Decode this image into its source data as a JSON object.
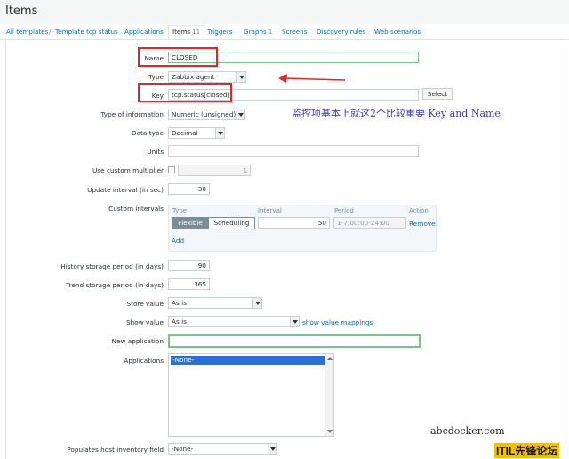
{
  "page_title": "Items",
  "tabs": [
    {
      "label": "All templates"
    },
    {
      "label": "Template tcp status"
    },
    {
      "label": "Applications"
    },
    {
      "label": "Items",
      "count": "11"
    },
    {
      "label": "Triggers"
    },
    {
      "label": "Graphs",
      "count": "1"
    },
    {
      "label": "Screens"
    },
    {
      "label": "Discovery rules"
    },
    {
      "label": "Web scenarios"
    }
  ],
  "breadcrumb_separator": "/",
  "form": {
    "name_label": "Name",
    "name_value": "CLOSED",
    "type_label": "Type",
    "type_value": "Zabbix agent",
    "key_label": "Key",
    "key_value": "tcp.status[closed]",
    "select_button": "Select",
    "type_info_label": "Type of information",
    "type_info_value": "Numeric (unsigned)",
    "data_type_label": "Data type",
    "data_type_value": "Decimal",
    "units_label": "Units",
    "units_value": "",
    "multiplier_label": "Use custom multiplier",
    "multiplier_value": "1",
    "update_interval_label": "Update interval (in sec)",
    "update_interval_value": "30",
    "custom_intervals_label": "Custom intervals",
    "ci_headers": {
      "type": "Type",
      "interval": "Interval",
      "period": "Period",
      "action": "Action"
    },
    "ci_flexible": "Flexible",
    "ci_scheduling": "Scheduling",
    "ci_interval_value": "50",
    "ci_period_value": "1-7,00:00-24:00",
    "ci_remove": "Remove",
    "ci_add": "Add",
    "history_label": "History storage period (in days)",
    "history_value": "90",
    "trend_label": "Trend storage period (in days)",
    "trend_value": "365",
    "store_value_label": "Store value",
    "store_value_value": "As is",
    "show_value_label": "Show value",
    "show_value_value": "As is",
    "show_value_mappings": "show value mappings",
    "new_application_label": "New application",
    "new_application_value": "",
    "applications_label": "Applications",
    "applications_options": [
      "-None-"
    ],
    "inventory_label": "Populates host inventory field",
    "inventory_value": "-None-"
  },
  "annotation_text": "监控项基本上就这2个比较重要   Key and Name",
  "watermark_site": "abcdocker.com",
  "watermark_forum": "ITIL先锋论坛",
  "colors": {
    "annotation_red": "#e2262a",
    "annotation_blue": "#3a3ab0",
    "link": "#0275b8",
    "forum_badge": "#f2c100"
  }
}
